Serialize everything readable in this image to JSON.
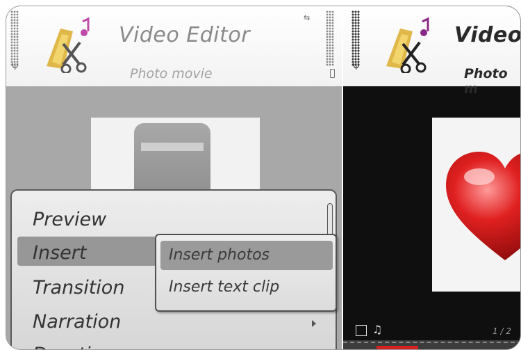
{
  "left_screen": {
    "app_title": "Video Editor",
    "subtitle": "Photo movie",
    "menu": {
      "items": [
        {
          "label": "Preview",
          "has_submenu": false
        },
        {
          "label": "Insert",
          "has_submenu": true,
          "selected": true
        },
        {
          "label": "Transition",
          "has_submenu": false
        },
        {
          "label": "Narration",
          "has_submenu": true
        },
        {
          "label": "Duration",
          "has_submenu": true
        }
      ]
    },
    "submenu": {
      "items": [
        {
          "label": "Insert photos",
          "selected": true
        },
        {
          "label": "Insert text clip"
        }
      ]
    }
  },
  "right_screen": {
    "app_title": "Video",
    "subtitle": "Photo m",
    "counter": "1 / 2"
  },
  "colors": {
    "header_bg": "#ffffff",
    "title_gray": "#8a8a8a",
    "menu_bg": "#e4e4e4",
    "menu_selected": "#979797",
    "heart_red": "#d22222",
    "timeline_red": "#d22222"
  },
  "icons": [
    "video-editor-logo-icon",
    "signal-strength-icon",
    "battery-icon",
    "antenna-icon",
    "usb-icon",
    "submenu-arrow-icon",
    "image-clip-icon",
    "music-note-icon",
    "heart-photo"
  ]
}
